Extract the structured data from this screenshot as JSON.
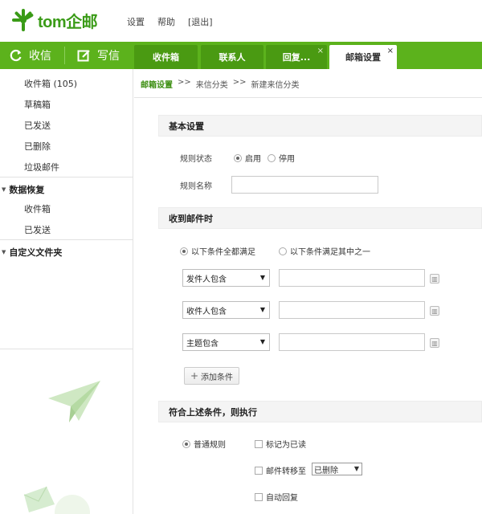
{
  "brand": {
    "name": "tom企邮",
    "color": "#5cb21c"
  },
  "top_links": [
    "设置",
    "帮助",
    "[退出]"
  ],
  "toolbar": {
    "refresh_label": "收信",
    "compose_label": "写信"
  },
  "tabs": [
    {
      "label": "收件箱"
    },
    {
      "label": "联系人"
    },
    {
      "label": "回复...",
      "close": "×"
    },
    {
      "label": "邮箱设置",
      "close": "×"
    }
  ],
  "sidebar": {
    "items": [
      "收件箱 (105)",
      "草稿箱",
      "已发送",
      "已删除",
      "垃圾邮件"
    ],
    "data_recovery": {
      "title": "数据恢复",
      "items": [
        "收件箱",
        "已发送"
      ]
    },
    "custom_folders": {
      "title": "自定义文件夹"
    }
  },
  "breadcrumb": {
    "link": "邮箱设置",
    "sep1": ">>",
    "item2": "来信分类",
    "sep2": ">>",
    "item3": "新建来信分类"
  },
  "basic": {
    "section_title": "基本设置",
    "status_label": "规则状态",
    "status_on": "启用",
    "status_off": "停用",
    "name_label": "规则名称",
    "name_value": ""
  },
  "receive": {
    "section_title": "收到邮件时",
    "match_all": "以下条件全都满足",
    "match_any": "以下条件满足其中之一",
    "conditions": [
      {
        "field": "发件人包含",
        "value": ""
      },
      {
        "field": "收件人包含",
        "value": ""
      },
      {
        "field": "主题包含",
        "value": ""
      }
    ],
    "add_condition": "添加条件"
  },
  "action": {
    "section_title": "符合上述条件，则执行",
    "normal_rule": "普通规则",
    "mark_read": "标记为已读",
    "move_to": "邮件转移至",
    "move_target": "已删除",
    "auto_reply": "自动回复"
  }
}
